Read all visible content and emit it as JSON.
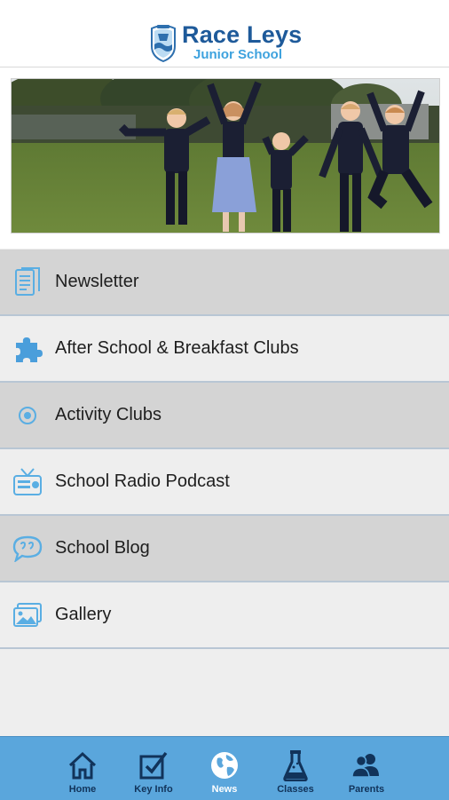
{
  "header": {
    "title": "Race Leys",
    "subtitle": "Junior School"
  },
  "banner": {
    "image": "children-jumping-photo"
  },
  "menu": {
    "items": [
      {
        "label": "Newsletter",
        "icon": "document-icon"
      },
      {
        "label": "After School & Breakfast Clubs",
        "icon": "puzzle-icon"
      },
      {
        "label": "Activity Clubs",
        "icon": "ball-icon"
      },
      {
        "label": "School Radio Podcast",
        "icon": "radio-icon"
      },
      {
        "label": "School Blog",
        "icon": "speech-bubble-icon"
      },
      {
        "label": "Gallery",
        "icon": "photos-icon"
      }
    ]
  },
  "tabbar": {
    "active": "News",
    "tabs": [
      {
        "label": "Home",
        "icon": "home-icon"
      },
      {
        "label": "Key Info",
        "icon": "checkbox-icon"
      },
      {
        "label": "News",
        "icon": "globe-icon"
      },
      {
        "label": "Classes",
        "icon": "flask-icon"
      },
      {
        "label": "Parents",
        "icon": "people-icon"
      }
    ]
  },
  "colors": {
    "brand_dark": "#1e5a9a",
    "brand_light": "#3ea2de",
    "icon_blue": "#5aaee3",
    "tabbar_bg": "#5aa6dc",
    "tab_label": "#11335a"
  }
}
